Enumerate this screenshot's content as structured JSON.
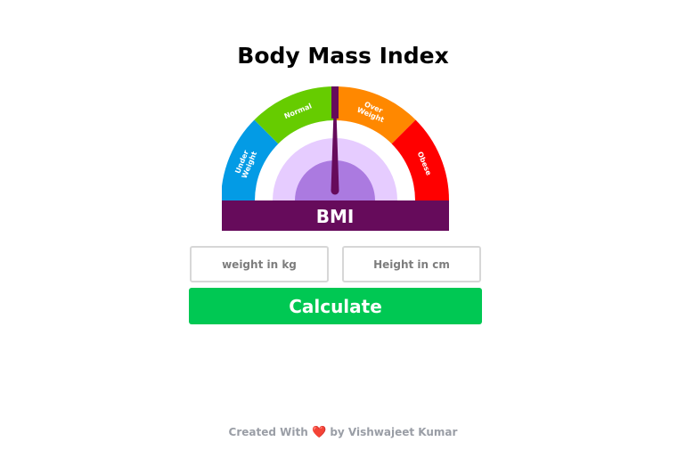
{
  "header": {
    "title": "Body Mass Index"
  },
  "gauge": {
    "center_label": "BMI",
    "needle_position": 0.5,
    "segments": [
      {
        "label": "Under Weight",
        "lines": [
          "Under",
          "Weight"
        ],
        "color": "#039be5"
      },
      {
        "label": "Normal",
        "lines": [
          "Normal"
        ],
        "color": "#66cc00"
      },
      {
        "label": "Over Weight",
        "lines": [
          "Over",
          "Weight"
        ],
        "color": "#ff8800"
      },
      {
        "label": "Obese",
        "lines": [
          "Obese"
        ],
        "color": "#ff0000"
      }
    ],
    "marker_color": "#660b5b",
    "band_color": "#660b5b",
    "inner_ring_color": "#e6ccff",
    "inner_disc_color": "#ab7ae0"
  },
  "form": {
    "weight_placeholder": "weight in kg",
    "height_placeholder": "Height in cm",
    "calculate_label": "Calculate",
    "button_color": "#00c853"
  },
  "footer": {
    "prefix": "Created With",
    "heart_icon": "heart-icon",
    "suffix": "by Vishwajeet Kumar"
  }
}
